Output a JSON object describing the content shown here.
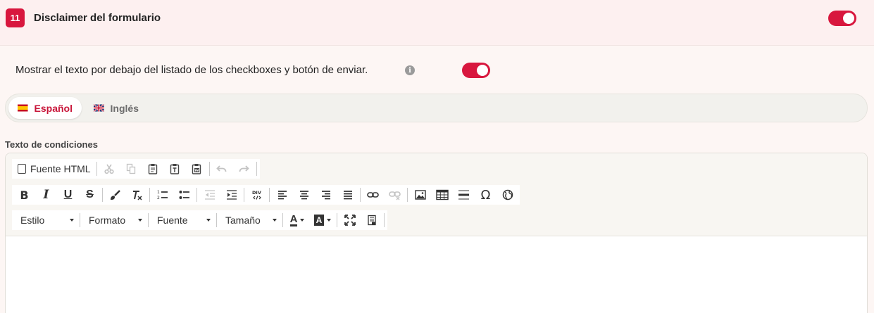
{
  "header": {
    "step_number": "11",
    "title": "Disclaimer del formulario",
    "toggle_on": true
  },
  "option": {
    "label": "Mostrar el texto por debajo del listado de los checkboxes y botón de enviar.",
    "info_glyph": "i",
    "toggle_on": true
  },
  "languages": {
    "tabs": [
      {
        "label": "Español",
        "flag": "spain-flag-icon",
        "active": true
      },
      {
        "label": "Inglés",
        "flag": "uk-flag-icon",
        "active": false
      }
    ]
  },
  "editor": {
    "label": "Texto de condiciones",
    "source_button": "Fuente HTML",
    "combos": {
      "style": "Estilo",
      "format": "Formato",
      "font": "Fuente",
      "size": "Tamaño"
    },
    "glyphs": {
      "bold": "B",
      "italic": "I",
      "underline": "U",
      "strike": "S",
      "special_char": "Ω",
      "text_color": "A",
      "bg_color": "A"
    },
    "content": ""
  },
  "colors": {
    "accent": "#d8173e",
    "header_bg": "#fdf0f0",
    "page_bg": "#fdf6f4"
  }
}
